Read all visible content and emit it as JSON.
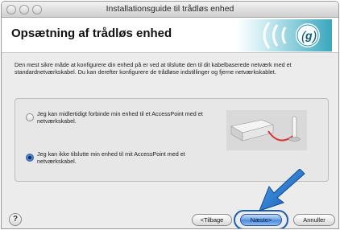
{
  "window": {
    "title": "Installationsguide til trådløs enhed"
  },
  "header": {
    "title": "Opsætning af trådløs enhed",
    "logo_icon": "wifi-waves-icon"
  },
  "description": "Den mest sikre måde at konfigurere din enhed på er ved at tilslutte den til dit kabelbaserede netværk med et standardnetværkskabel. Du kan derefter konfigurere de trådløse indstillinger og fjerne netværkskablet.",
  "options": [
    {
      "label": "Jeg kan midlertidigt forbinde min enhed til et AccessPoint med et netværkskabel.",
      "selected": false
    },
    {
      "label": "Jeg kan ikke tilslutte min enhed til mit AccessPoint med et netværkskabel.",
      "selected": true
    }
  ],
  "buttons": {
    "help": "?",
    "back": "<Tilbage",
    "next": "Næste>",
    "cancel": "Annuller"
  },
  "colors": {
    "accent": "#2c63b5",
    "arrow": "#1f6fc8",
    "cable": "#e03030"
  }
}
